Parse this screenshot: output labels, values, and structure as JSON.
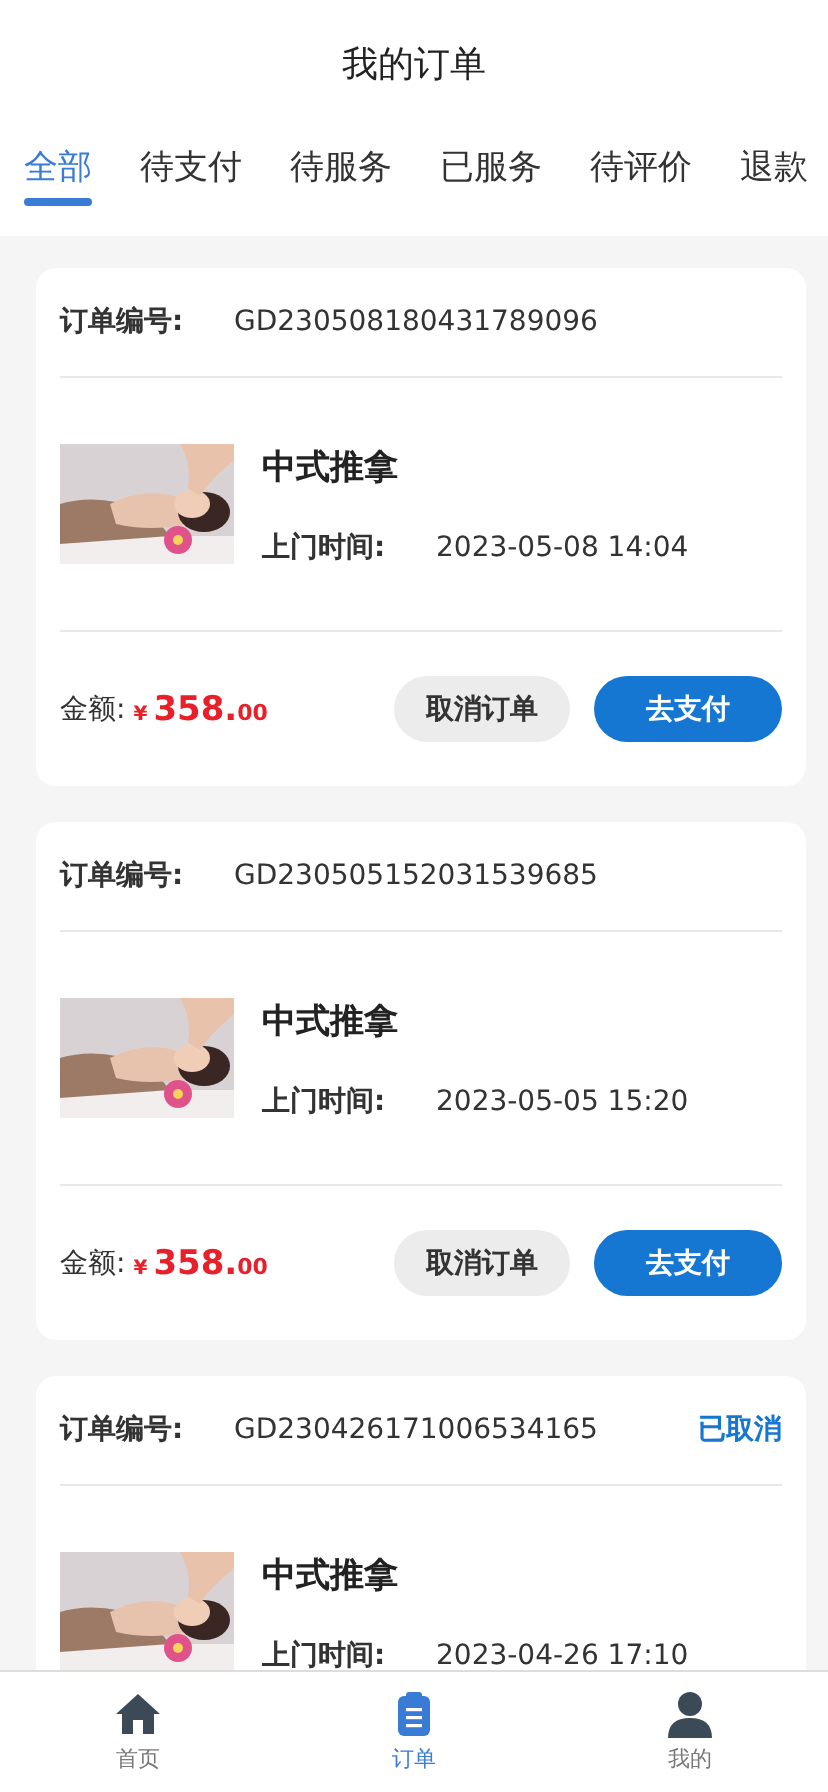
{
  "header": {
    "title": "我的订单"
  },
  "tabs": [
    {
      "label": "全部",
      "selected": true
    },
    {
      "label": "待支付",
      "selected": false
    },
    {
      "label": "待服务",
      "selected": false
    },
    {
      "label": "已服务",
      "selected": false
    },
    {
      "label": "待评价",
      "selected": false
    },
    {
      "label": "退款",
      "selected": false
    }
  ],
  "orders": [
    {
      "order_label": "订单编号:",
      "order_no": "GD230508180431789096",
      "item": {
        "kind": "picture",
        "name": "中式推拿",
        "time_label": "上门时间:",
        "time": "2023-05-08 14:04"
      },
      "amount_label": "金额:",
      "currency": "¥",
      "price_int": "358.",
      "price_dec": "00",
      "buttons": [
        {
          "label": "取消订单",
          "kind": "secondary"
        },
        {
          "label": "去支付",
          "kind": "primary"
        }
      ]
    },
    {
      "order_label": "订单编号:",
      "order_no": "GD230505152031539685",
      "item": {
        "kind": "picture",
        "name": "中式推拿",
        "time_label": "上门时间:",
        "time": "2023-05-05 15:20"
      },
      "amount_label": "金额:",
      "currency": "¥",
      "price_int": "358.",
      "price_dec": "00",
      "buttons": [
        {
          "label": "取消订单",
          "kind": "secondary"
        },
        {
          "label": "去支付",
          "kind": "primary"
        }
      ]
    },
    {
      "order_label": "订单编号:",
      "order_no": "GD230426171006534165",
      "status": "已取消",
      "item": {
        "kind": "picture",
        "name": "中式推拿",
        "time_label": "上门时间:",
        "time": "2023-04-26 17:10"
      }
    }
  ],
  "bottom_nav": [
    {
      "label": "首页",
      "kind": "home",
      "selected": false
    },
    {
      "label": "订单",
      "kind": "order",
      "selected": true
    },
    {
      "label": "我的",
      "kind": "user",
      "selected": false
    }
  ]
}
